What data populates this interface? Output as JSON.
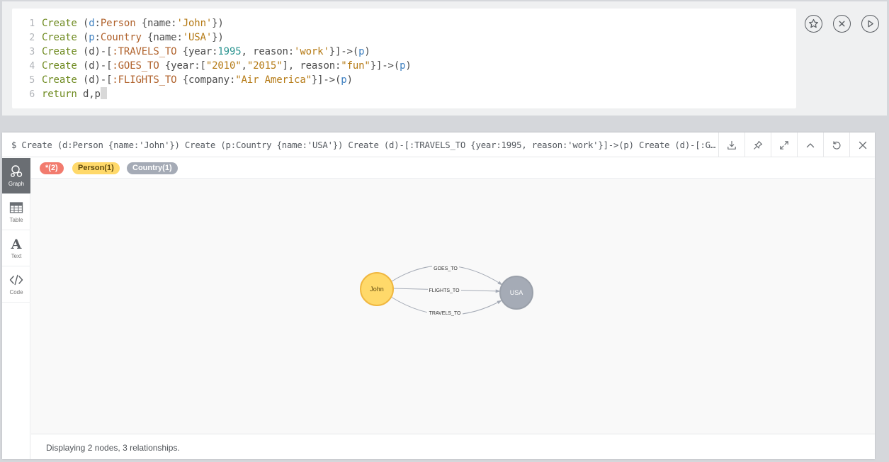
{
  "editor": {
    "lines": [
      {
        "num": "1",
        "tokens": [
          [
            "kw",
            "Create"
          ],
          [
            "pl",
            " ("
          ],
          [
            "vr",
            "d"
          ],
          [
            "pl",
            ":"
          ],
          [
            "lb",
            "Person"
          ],
          [
            "pl",
            " {name:"
          ],
          [
            "st",
            "'John'"
          ],
          [
            "pl",
            "})"
          ]
        ]
      },
      {
        "num": "2",
        "tokens": [
          [
            "kw",
            "Create"
          ],
          [
            "pl",
            " ("
          ],
          [
            "vr",
            "p"
          ],
          [
            "pl",
            ":"
          ],
          [
            "lb",
            "Country"
          ],
          [
            "pl",
            " {name:"
          ],
          [
            "st",
            "'USA'"
          ],
          [
            "pl",
            "})"
          ]
        ]
      },
      {
        "num": "3",
        "tokens": [
          [
            "kw",
            "Create"
          ],
          [
            "pl",
            " (d)-["
          ],
          [
            "lb",
            ":TRAVELS_TO"
          ],
          [
            "pl",
            " {year:"
          ],
          [
            "nm",
            "1995"
          ],
          [
            "pl",
            ", reason:"
          ],
          [
            "st",
            "'work'"
          ],
          [
            "pl",
            "}]->("
          ],
          [
            "vr",
            "p"
          ],
          [
            "pl",
            ")"
          ]
        ]
      },
      {
        "num": "4",
        "tokens": [
          [
            "kw",
            "Create"
          ],
          [
            "pl",
            " (d)-["
          ],
          [
            "lb",
            ":GOES_TO"
          ],
          [
            "pl",
            " {year:["
          ],
          [
            "st",
            "\"2010\""
          ],
          [
            "pl",
            ","
          ],
          [
            "st",
            "\"2015\""
          ],
          [
            "pl",
            "], reason:"
          ],
          [
            "st",
            "\"fun\""
          ],
          [
            "pl",
            "}]->("
          ],
          [
            "vr",
            "p"
          ],
          [
            "pl",
            ")"
          ]
        ]
      },
      {
        "num": "5",
        "tokens": [
          [
            "kw",
            "Create"
          ],
          [
            "pl",
            " (d)-["
          ],
          [
            "lb",
            ":FLIGHTS_TO"
          ],
          [
            "pl",
            " {company:"
          ],
          [
            "st",
            "\"Air America\""
          ],
          [
            "pl",
            "}]->("
          ],
          [
            "vr",
            "p"
          ],
          [
            "pl",
            ")"
          ]
        ]
      },
      {
        "num": "6",
        "tokens": [
          [
            "kw",
            "return"
          ],
          [
            "pl",
            " d,p"
          ]
        ]
      }
    ],
    "buttons": {
      "favorite": "star-icon",
      "clear": "close-circle-icon",
      "run": "play-icon"
    }
  },
  "result": {
    "query": "$ Create (d:Person {name:'John'}) Create (p:Country {name:'USA'}) Create (d)-[:TRAVELS_TO {year:1995, reason:'work'}]->(p) Create (d)-[:GOES_TO {year:[\"2010\",\"2015\"], reason:\"fun\"}]->(p) Create (d)-[:FLIGHTS_TO {company:\"Air America\"}]->(p) return d,p",
    "header_buttons": [
      "download-icon",
      "pin-icon",
      "expand-icon",
      "collapse-icon",
      "rerun-icon",
      "close-icon"
    ],
    "sidebar": [
      {
        "label": "Graph",
        "icon": "graph-icon",
        "active": true
      },
      {
        "label": "Table",
        "icon": "table-icon",
        "active": false
      },
      {
        "label": "Text",
        "icon": "text-icon",
        "active": false
      },
      {
        "label": "Code",
        "icon": "code-icon",
        "active": false
      }
    ],
    "legend": [
      {
        "label": "*(2)",
        "color": "#f27b6e",
        "text_color": "#ffffff"
      },
      {
        "label": "Person(1)",
        "color": "#ffd96a",
        "text_color": "#604a0e"
      },
      {
        "label": "Country(1)",
        "color": "#a5abb6",
        "text_color": "#ffffff"
      }
    ],
    "graph": {
      "nodes": [
        {
          "id": "d",
          "caption": "John",
          "fill": "#ffd96a",
          "stroke": "#f0b740",
          "text_color": "#604a0e"
        },
        {
          "id": "p",
          "caption": "USA",
          "fill": "#a5abb6",
          "stroke": "#9aa0aa",
          "text_color": "#ffffff"
        }
      ],
      "relationships": [
        {
          "type": "GOES_TO",
          "from": "d",
          "to": "p"
        },
        {
          "type": "FLIGHTS_TO",
          "from": "d",
          "to": "p"
        },
        {
          "type": "TRAVELS_TO",
          "from": "d",
          "to": "p"
        }
      ]
    },
    "status": "Displaying 2 nodes, 3 relationships."
  }
}
